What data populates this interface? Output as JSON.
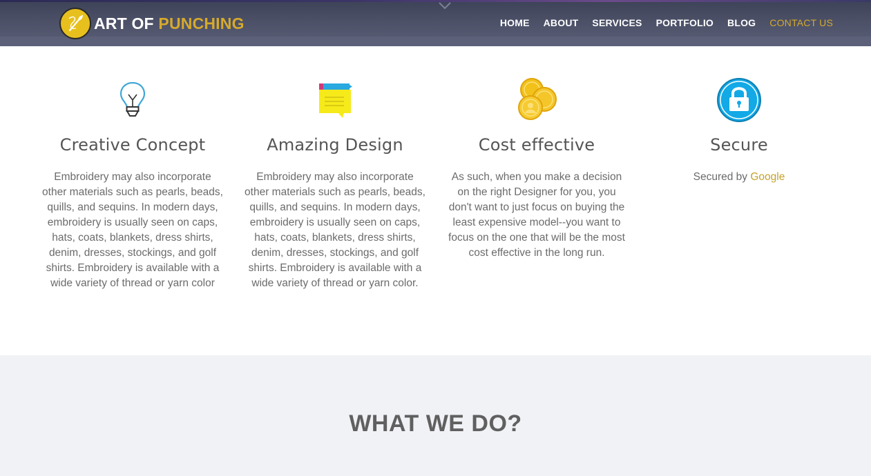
{
  "header": {
    "logo": {
      "text_white": "ART OF",
      "text_gold": "PUNCHING",
      "icon": "needle-thread-icon"
    },
    "nav": [
      {
        "label": "HOME",
        "active": false
      },
      {
        "label": "ABOUT",
        "active": false
      },
      {
        "label": "SERVICES",
        "active": false
      },
      {
        "label": "PORTFOLIO",
        "active": false
      },
      {
        "label": "BLOG",
        "active": false
      },
      {
        "label": "CONTACT US",
        "active": true
      }
    ],
    "accent_color": "#d6aa2c"
  },
  "features": [
    {
      "icon": "lightbulb-icon",
      "title": "Creative Concept",
      "text": "Embroidery may also incorporate other materials such as pearls, beads, quills, and sequins. In modern days, embroidery is usually seen on caps, hats, coats, blankets, dress shirts, denim, dresses, stockings, and golf shirts. Embroidery is available with a wide variety of thread or yarn color"
    },
    {
      "icon": "notepad-icon",
      "title": "Amazing Design",
      "text": "Embroidery may also incorporate other materials such as pearls, beads, quills, and sequins. In modern days, embroidery is usually seen on caps, hats, coats, blankets, dress shirts, denim, dresses, stockings, and golf shirts. Embroidery is available with a wide variety of thread or yarn color."
    },
    {
      "icon": "coins-icon",
      "title": "Cost effective",
      "text": "As such, when you make a decision on the right Designer for you, you don't want to just focus on buying the least expensive model--you want to focus on the one that will be the most cost effective in the long run."
    },
    {
      "icon": "padlock-icon",
      "title": "Secure",
      "text_prefix": "Secured by",
      "link": "Google"
    }
  ],
  "what_we_do": {
    "title": "WHAT WE DO?"
  }
}
